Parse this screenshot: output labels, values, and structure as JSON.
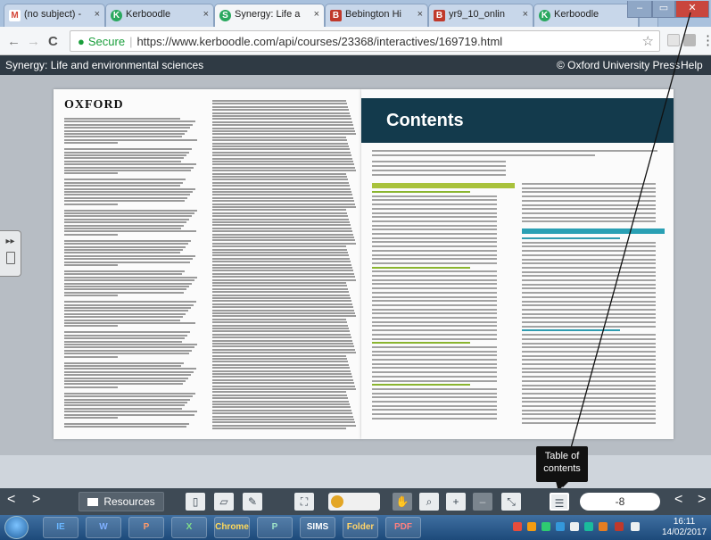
{
  "browser": {
    "tabs": [
      {
        "title": "(no subject) -",
        "favicon": "M",
        "favicon_color": "#d44638",
        "active": false
      },
      {
        "title": "Kerboodle",
        "favicon": "K",
        "favicon_color": "#2aa85f",
        "active": false
      },
      {
        "title": "Synergy: Life a",
        "favicon": "S",
        "favicon_color": "#2aa85f",
        "active": true
      },
      {
        "title": "Bebington Hi",
        "favicon": "B",
        "favicon_color": "#c0392b",
        "active": false
      },
      {
        "title": "yr9_10_onlin",
        "favicon": "B",
        "favicon_color": "#c0392b",
        "active": false
      },
      {
        "title": "Kerboodle",
        "favicon": "K",
        "favicon_color": "#2aa85f",
        "active": false
      }
    ],
    "close_glyph": "×",
    "window_controls": {
      "minimize": "–",
      "restore": "▭",
      "close": "✕"
    },
    "nav": {
      "back": "←",
      "forward": "→",
      "reload": "C"
    },
    "address": {
      "secure_label": "Secure",
      "separator": "|",
      "url": "https://www.kerboodle.com/api/courses/23368/interactives/169719.html"
    },
    "star": "☆",
    "menu": "⋮"
  },
  "app": {
    "title": "Synergy: Life and environmental sciences",
    "publisher": "© Oxford University Press",
    "help": "Help"
  },
  "reader": {
    "side_tab": "▸▸",
    "left_page": {
      "publisher_logo_text": "OXFORD"
    },
    "right_page": {
      "heading": "Contents"
    }
  },
  "annotation": {
    "tooltip_line1": "Table of",
    "tooltip_line2": "contents"
  },
  "toolbar": {
    "prev": "<",
    "next": ">",
    "resources_label": "Resources",
    "page_value": "-8",
    "prev_page": "<",
    "next_page": ">",
    "icons": [
      "single-page-icon",
      "bookmark-icon",
      "pen-icon",
      "fullscreen-icon",
      "toggle-icon",
      "hand-icon",
      "zoom-search-icon",
      "zoom-in-icon",
      "zoom-out-icon",
      "zoom-fit-icon",
      "table-of-contents-icon"
    ]
  },
  "taskbar": {
    "apps": [
      "IE",
      "W",
      "P",
      "X",
      "Chrome",
      "P",
      "SIMS",
      "Folder",
      "PDF"
    ],
    "clock_time": "16:11",
    "clock_date": "14/02/2017"
  },
  "colors": {
    "app_header": "#2f3a44",
    "contents_banner": "#133a4c",
    "section_green": "#a9c23c",
    "section_blue": "#2aa0b4",
    "toolbar": "#3e4a55"
  }
}
